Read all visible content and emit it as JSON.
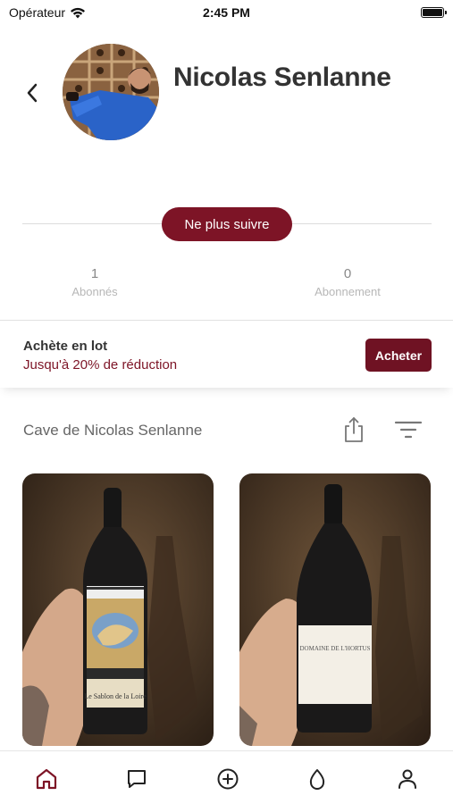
{
  "status_bar": {
    "carrier": "Opérateur",
    "time": "2:45 PM"
  },
  "profile": {
    "name": "Nicolas Senlanne",
    "follow_button": "Ne plus suivre"
  },
  "stats": [
    {
      "value": "1",
      "label": "Abonnés"
    },
    {
      "value": "0",
      "label": "Abonnement"
    }
  ],
  "promo": {
    "title": "Achète en lot",
    "subtitle": "Jusqu'à 20% de réduction",
    "button": "Acheter"
  },
  "cellar": {
    "title": "Cave de Nicolas Senlanne",
    "cards": [
      {
        "label_text": "Le Sablon de la Loire",
        "icon": "wine-bottle-photo"
      },
      {
        "label_text": "DOMAINE DE L'HORTUS",
        "icon": "wine-bottle-photo"
      }
    ]
  },
  "tab_bar": {
    "tabs": [
      "home-icon",
      "chat-icon",
      "add-icon",
      "drop-icon",
      "profile-icon"
    ],
    "active_color": "#7d1426"
  },
  "colors": {
    "brand": "#7d1426",
    "brand_dark": "#6f1223"
  }
}
